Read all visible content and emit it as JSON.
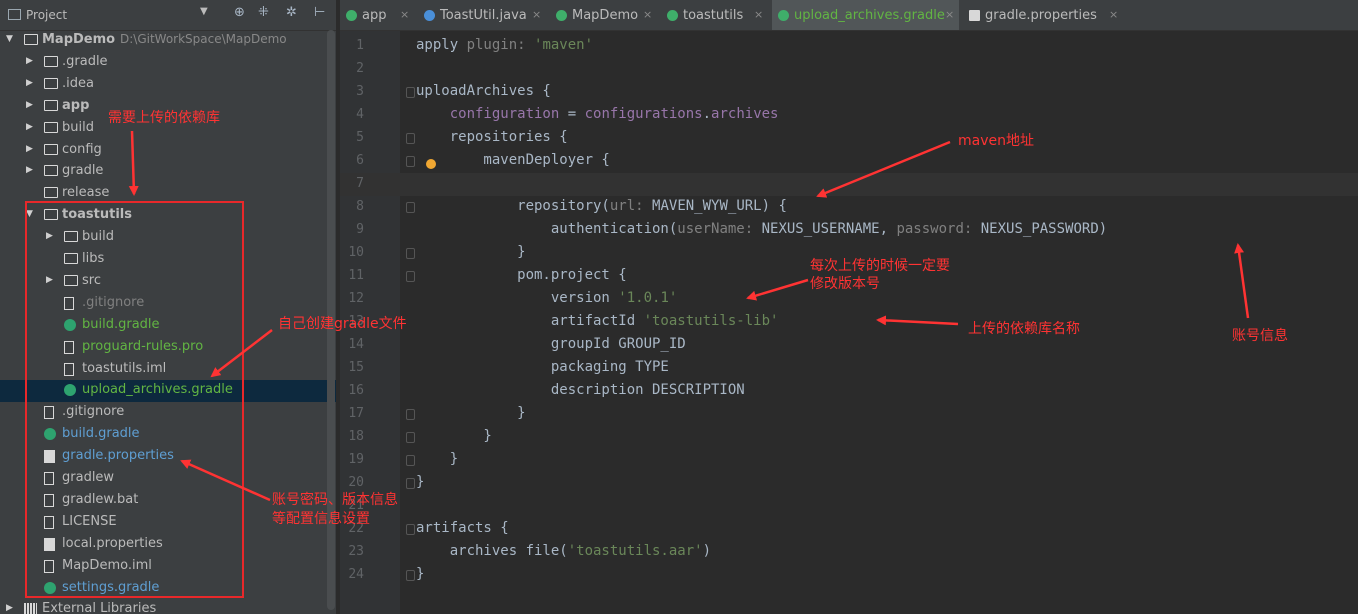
{
  "project_panel": {
    "title": "Project",
    "tree": [
      {
        "label": "MapDemo",
        "path": "D:\\GitWorkSpace\\MapDemo",
        "icon": "module-folder-icon",
        "arrow": "▼",
        "bold": true
      },
      {
        "label": ".gradle",
        "icon": "folder-icon",
        "arrow": "▶"
      },
      {
        "label": ".idea",
        "icon": "folder-icon",
        "arrow": "▶"
      },
      {
        "label": "app",
        "icon": "module-folder-icon",
        "arrow": "▶",
        "bold": true
      },
      {
        "label": "build",
        "icon": "folder-icon",
        "arrow": "▶"
      },
      {
        "label": "config",
        "icon": "folder-icon",
        "arrow": "▶"
      },
      {
        "label": "gradle",
        "icon": "folder-icon",
        "arrow": "▶"
      },
      {
        "label": "release",
        "icon": "folder-icon",
        "arrow": ""
      },
      {
        "label": "toastutils",
        "icon": "module-folder-icon",
        "arrow": "▼",
        "bold": true
      },
      {
        "label": "build",
        "icon": "folder-icon",
        "arrow": "▶"
      },
      {
        "label": "libs",
        "icon": "folder-icon",
        "arrow": ""
      },
      {
        "label": "src",
        "icon": "folder-icon",
        "arrow": "▶"
      },
      {
        "label": ".gitignore",
        "icon": "file-icon",
        "arrow": "",
        "color": "ign"
      },
      {
        "label": "build.gradle",
        "icon": "gradle-icon",
        "arrow": "",
        "color": "green"
      },
      {
        "label": "proguard-rules.pro",
        "icon": "file-icon",
        "arrow": "",
        "color": "green"
      },
      {
        "label": "toastutils.iml",
        "icon": "file-icon",
        "arrow": ""
      },
      {
        "label": "upload_archives.gradle",
        "icon": "gradle-icon",
        "arrow": "",
        "color": "green",
        "selected": true
      },
      {
        "label": ".gitignore",
        "icon": "file-icon",
        "arrow": ""
      },
      {
        "label": "build.gradle",
        "icon": "gradle-icon",
        "arrow": "",
        "color": "blue"
      },
      {
        "label": "gradle.properties",
        "icon": "properties-icon",
        "arrow": "",
        "color": "blue"
      },
      {
        "label": "gradlew",
        "icon": "file-icon",
        "arrow": ""
      },
      {
        "label": "gradlew.bat",
        "icon": "file-icon",
        "arrow": ""
      },
      {
        "label": "LICENSE",
        "icon": "file-icon",
        "arrow": ""
      },
      {
        "label": "local.properties",
        "icon": "properties-icon",
        "arrow": ""
      },
      {
        "label": "MapDemo.iml",
        "icon": "file-icon",
        "arrow": ""
      },
      {
        "label": "settings.gradle",
        "icon": "gradle-icon",
        "arrow": "",
        "color": "blue"
      },
      {
        "label": "External Libraries",
        "icon": "libraries-icon",
        "arrow": "▶"
      }
    ]
  },
  "tabs": [
    {
      "label": "app",
      "icon": "gradle-icon",
      "close": "×"
    },
    {
      "label": "ToastUtil.java",
      "icon": "class-icon",
      "close": "×"
    },
    {
      "label": "MapDemo",
      "icon": "gradle-icon",
      "close": "×"
    },
    {
      "label": "toastutils",
      "icon": "gradle-icon",
      "close": "×"
    },
    {
      "label": "upload_archives.gradle",
      "icon": "gradle-icon",
      "close": "×",
      "active": true
    },
    {
      "label": "gradle.properties",
      "icon": "properties-icon",
      "close": "×"
    }
  ],
  "editor": {
    "lines": [
      [
        [
          "apply ",
          "plain"
        ],
        [
          "plugin: ",
          "param"
        ],
        [
          "'maven'",
          "str"
        ]
      ],
      [],
      [
        [
          "uploadArchives {",
          "plain"
        ]
      ],
      [
        [
          "    ",
          "plain"
        ],
        [
          "configuration",
          "field"
        ],
        [
          " = ",
          "plain"
        ],
        [
          "configurations",
          "field"
        ],
        [
          ".",
          "plain"
        ],
        [
          "archives",
          "field"
        ]
      ],
      [
        [
          "    repositories {",
          "plain"
        ]
      ],
      [
        [
          "        mavenDeployer {",
          "plain"
        ]
      ],
      [],
      [
        [
          "            repository(",
          "plain"
        ],
        [
          "url: ",
          "param"
        ],
        [
          "MAVEN_WYW_URL) {",
          "plain"
        ]
      ],
      [
        [
          "                authentication(",
          "plain"
        ],
        [
          "userName: ",
          "param"
        ],
        [
          "NEXUS_USERNAME, ",
          "plain"
        ],
        [
          "password: ",
          "param"
        ],
        [
          "NEXUS_PASSWORD)",
          "plain"
        ]
      ],
      [
        [
          "            }",
          "plain"
        ]
      ],
      [
        [
          "            pom.project {",
          "plain"
        ]
      ],
      [
        [
          "                version ",
          "plain"
        ],
        [
          "'1.0.1'",
          "str"
        ]
      ],
      [
        [
          "                artifactId ",
          "plain"
        ],
        [
          "'toastutils-lib'",
          "str"
        ]
      ],
      [
        [
          "                groupId GROUP_ID",
          "plain"
        ]
      ],
      [
        [
          "                packaging TYPE",
          "plain"
        ]
      ],
      [
        [
          "                description DESCRIPTION",
          "plain"
        ]
      ],
      [
        [
          "            }",
          "plain"
        ]
      ],
      [
        [
          "        }",
          "plain"
        ]
      ],
      [
        [
          "    }",
          "plain"
        ]
      ],
      [
        [
          "}",
          "plain"
        ]
      ],
      [],
      [
        [
          "artifacts {",
          "plain"
        ]
      ],
      [
        [
          "    archives file(",
          "plain"
        ],
        [
          "'toastutils.aar'",
          "str"
        ],
        [
          ")",
          "plain"
        ]
      ],
      [
        [
          "}",
          "plain"
        ]
      ]
    ],
    "line_numbers": [
      "1",
      "2",
      "3",
      "4",
      "5",
      "6",
      "7",
      "8",
      "9",
      "10",
      "11",
      "12",
      "13",
      "14",
      "15",
      "16",
      "17",
      "18",
      "19",
      "20",
      "21",
      "22",
      "23",
      "24"
    ]
  },
  "annotations": {
    "upload_lib": "需要上传的依赖库",
    "create_gradle": "自己创建gradle文件",
    "account_config_line1": "账号密码、版本信息",
    "account_config_line2": "等配置信息设置",
    "maven_address": "maven地址",
    "version_line1": "每次上传的时候一定要",
    "version_line2": "修改版本号",
    "lib_name": "上传的依赖库名称",
    "account_info": "账号信息"
  },
  "colors": {
    "annotation_red": "#ff3333",
    "keyword_param": "#808080",
    "string": "#6a8759",
    "field": "#9876aa",
    "gradle_green": "#62b543",
    "file_blue": "#5f9fd3"
  }
}
